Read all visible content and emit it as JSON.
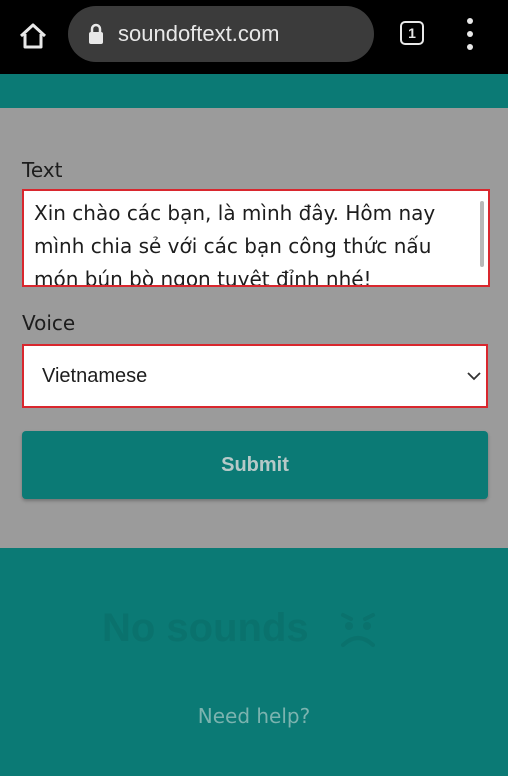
{
  "browser": {
    "url": "soundoftext.com",
    "tab_count": "1",
    "icons": [
      "home-icon",
      "lock-icon",
      "tab-switcher-icon",
      "more-vert-icon"
    ]
  },
  "form": {
    "text_label": "Text",
    "text_value": "Xin chào các bạn, là mình đây. Hôm nay mình chia sẻ với các bạn công thức nấu món bún bò ngon tuyệt đỉnh nhé!",
    "voice_label": "Voice",
    "voice_value": "Vietnamese",
    "submit_label": "Submit"
  },
  "sounds": {
    "empty_text": "No sounds",
    "empty_icon": "sad-face-icon",
    "help_link": "Need help?"
  },
  "colors": {
    "brand_teal": "#0b7a75",
    "highlight_red": "#d9272e",
    "overlay_gray": "#9b9b9b",
    "browser_black": "#000000"
  }
}
